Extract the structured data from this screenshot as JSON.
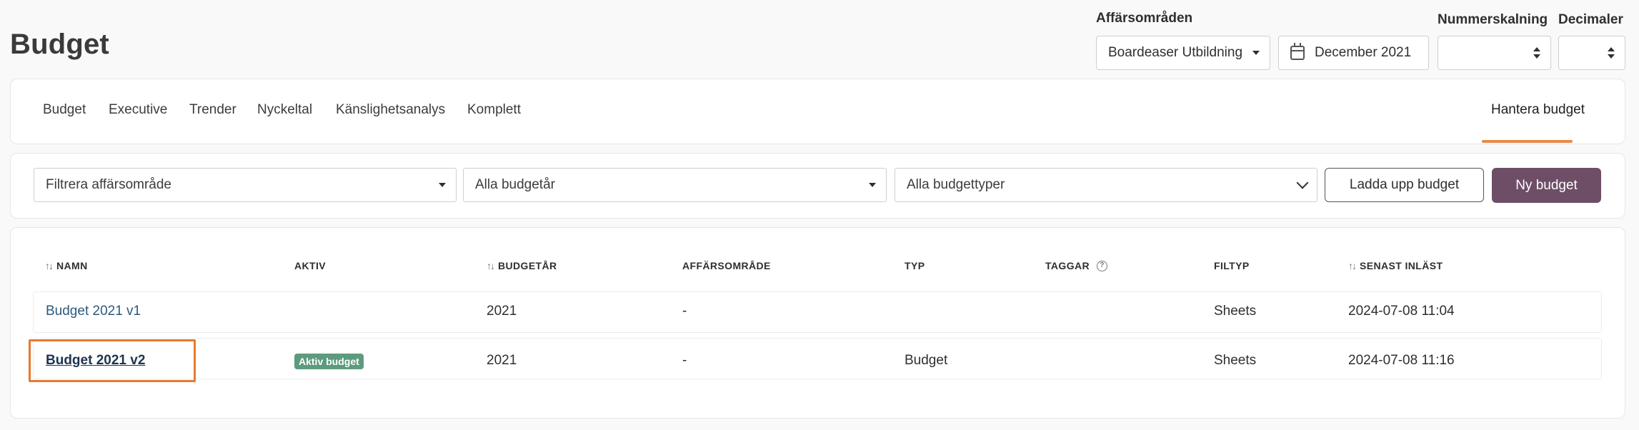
{
  "page": {
    "title": "Budget"
  },
  "header": {
    "business_areas": {
      "label": "Affärsområden",
      "value": "Boardeaser Utbildning"
    },
    "date": {
      "value": "December 2021"
    },
    "number_scaling": {
      "label": "Nummerskalning",
      "value": ""
    },
    "decimals": {
      "label": "Decimaler",
      "value": ""
    }
  },
  "tabs": [
    {
      "label": "Budget"
    },
    {
      "label": "Executive"
    },
    {
      "label": "Trender"
    },
    {
      "label": "Nyckeltal"
    },
    {
      "label": "Känslighetsanalys"
    },
    {
      "label": "Komplett"
    }
  ],
  "manage_tab": {
    "label": "Hantera budget",
    "active": true
  },
  "filters": {
    "business_area": {
      "placeholder": "Filtrera affärsområde"
    },
    "budget_year": {
      "value": "Alla budgetår"
    },
    "budget_type": {
      "value": "Alla budgettyper"
    },
    "upload_label": "Ladda upp budget",
    "new_label": "Ny budget"
  },
  "table": {
    "columns": {
      "name": "NAMN",
      "active": "AKTIV",
      "budget_year": "BUDGETÅR",
      "business_area": "AFFÄRSOMRÅDE",
      "type": "TYP",
      "tags": "TAGGAR",
      "file_type": "FILTYP",
      "last_loaded": "SENAST INLÄST"
    },
    "rows": [
      {
        "name": "Budget 2021 v1",
        "active": "",
        "budget_year": "2021",
        "business_area": "-",
        "type": "",
        "tags": "",
        "file_type": "Sheets",
        "last_loaded": "2024-07-08 11:04"
      },
      {
        "name": "Budget 2021 v2",
        "active": "Aktiv budget",
        "budget_year": "2021",
        "business_area": "-",
        "type": "Budget",
        "tags": "",
        "file_type": "Sheets",
        "last_loaded": "2024-07-08 11:16"
      }
    ]
  },
  "colors": {
    "primary_button": "#6e4e67",
    "tab_underline": "#e58b4b",
    "active_badge": "#5c9b7c",
    "link": "#2b5a7c",
    "highlight": "#e8792d"
  }
}
